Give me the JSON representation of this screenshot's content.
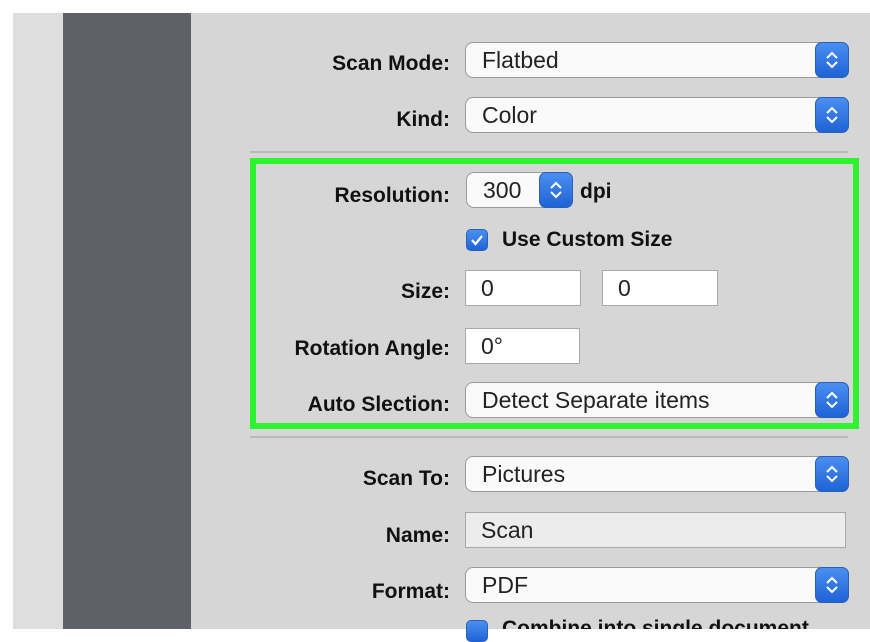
{
  "scan_mode": {
    "label": "Scan Mode:",
    "value": "Flatbed"
  },
  "kind": {
    "label": "Kind:",
    "value": "Color"
  },
  "resolution": {
    "label": "Resolution:",
    "value": "300",
    "unit": "dpi"
  },
  "use_custom_size": {
    "label": "Use Custom Size",
    "checked": true
  },
  "size": {
    "label": "Size:",
    "width": "0",
    "height": "0"
  },
  "rotation": {
    "label": "Rotation Angle:",
    "value": "0°"
  },
  "auto_selection": {
    "label": "Auto Slection:",
    "value": "Detect Separate items"
  },
  "scan_to": {
    "label": "Scan To:",
    "value": "Pictures"
  },
  "name": {
    "label": "Name:",
    "value": "Scan"
  },
  "format": {
    "label": "Format:",
    "value": "PDF"
  },
  "combine_partial": {
    "label": "Combine into single document"
  },
  "colors": {
    "highlight": "#2ef42f",
    "accent": "#2b74e6",
    "sidebar": "#5f6168"
  }
}
